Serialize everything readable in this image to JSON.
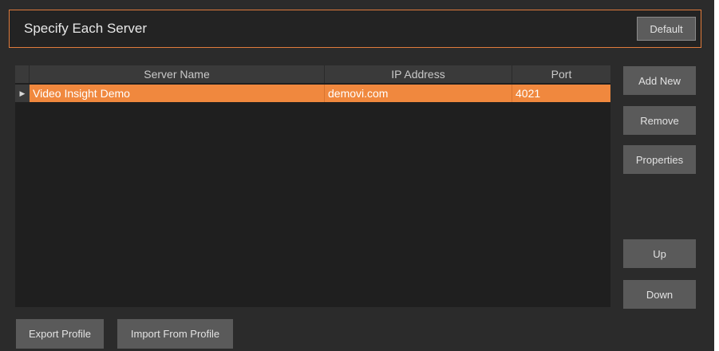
{
  "header": {
    "title": "Specify Each Server",
    "default_label": "Default"
  },
  "grid": {
    "columns": [
      "Server Name",
      "IP Address",
      "Port"
    ],
    "rows": [
      {
        "server_name": "Video Insight Demo",
        "ip_address": "demovi.com",
        "port": "4021",
        "selected": true,
        "indicator_icon": "row-pointer-icon"
      }
    ]
  },
  "side_buttons": {
    "add_new": "Add New",
    "remove": "Remove",
    "properties": "Properties",
    "up": "Up",
    "down": "Down"
  },
  "bottom_buttons": {
    "export": "Export Profile",
    "import": "Import From Profile"
  },
  "colors": {
    "accent": "#f0883e",
    "header_border": "#e07b3c",
    "background": "#2b2b2b",
    "button": "#5a5a5a"
  }
}
